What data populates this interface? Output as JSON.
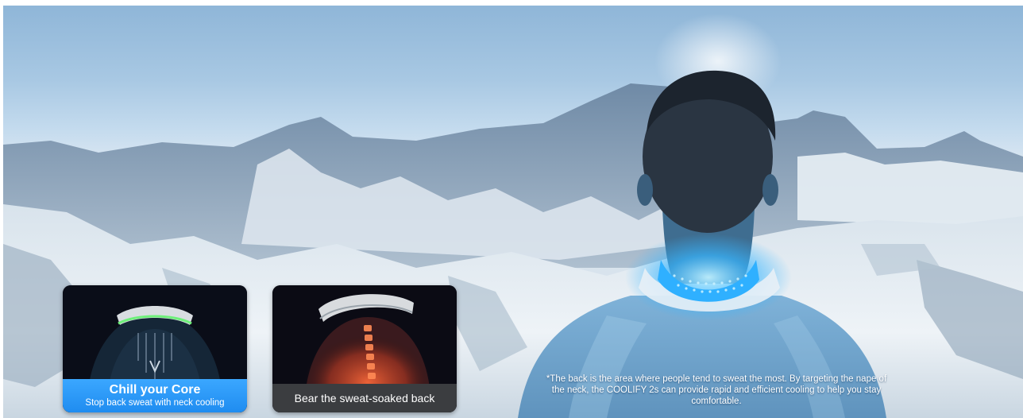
{
  "scene": {
    "description_icon": "mountain-landscape",
    "colors": {
      "sky_top": "#8fb6d8",
      "snow": "#e8eff5",
      "glow": "#38b6ff",
      "card_blue": "#2496f5",
      "card_dark": "#3b3d40"
    }
  },
  "cards": [
    {
      "title": "Chill your Core",
      "subtitle": "Stop back sweat with neck cooling",
      "icon": "cooling-back-illustration"
    },
    {
      "label": "Bear the sweat-soaked back",
      "icon": "sweaty-back-illustration"
    }
  ],
  "footnote": "*The back is the area where people tend to sweat the most. By targeting the nape of the neck, the COOLIFY 2s can provide rapid and efficient cooling to help you stay comfortable."
}
